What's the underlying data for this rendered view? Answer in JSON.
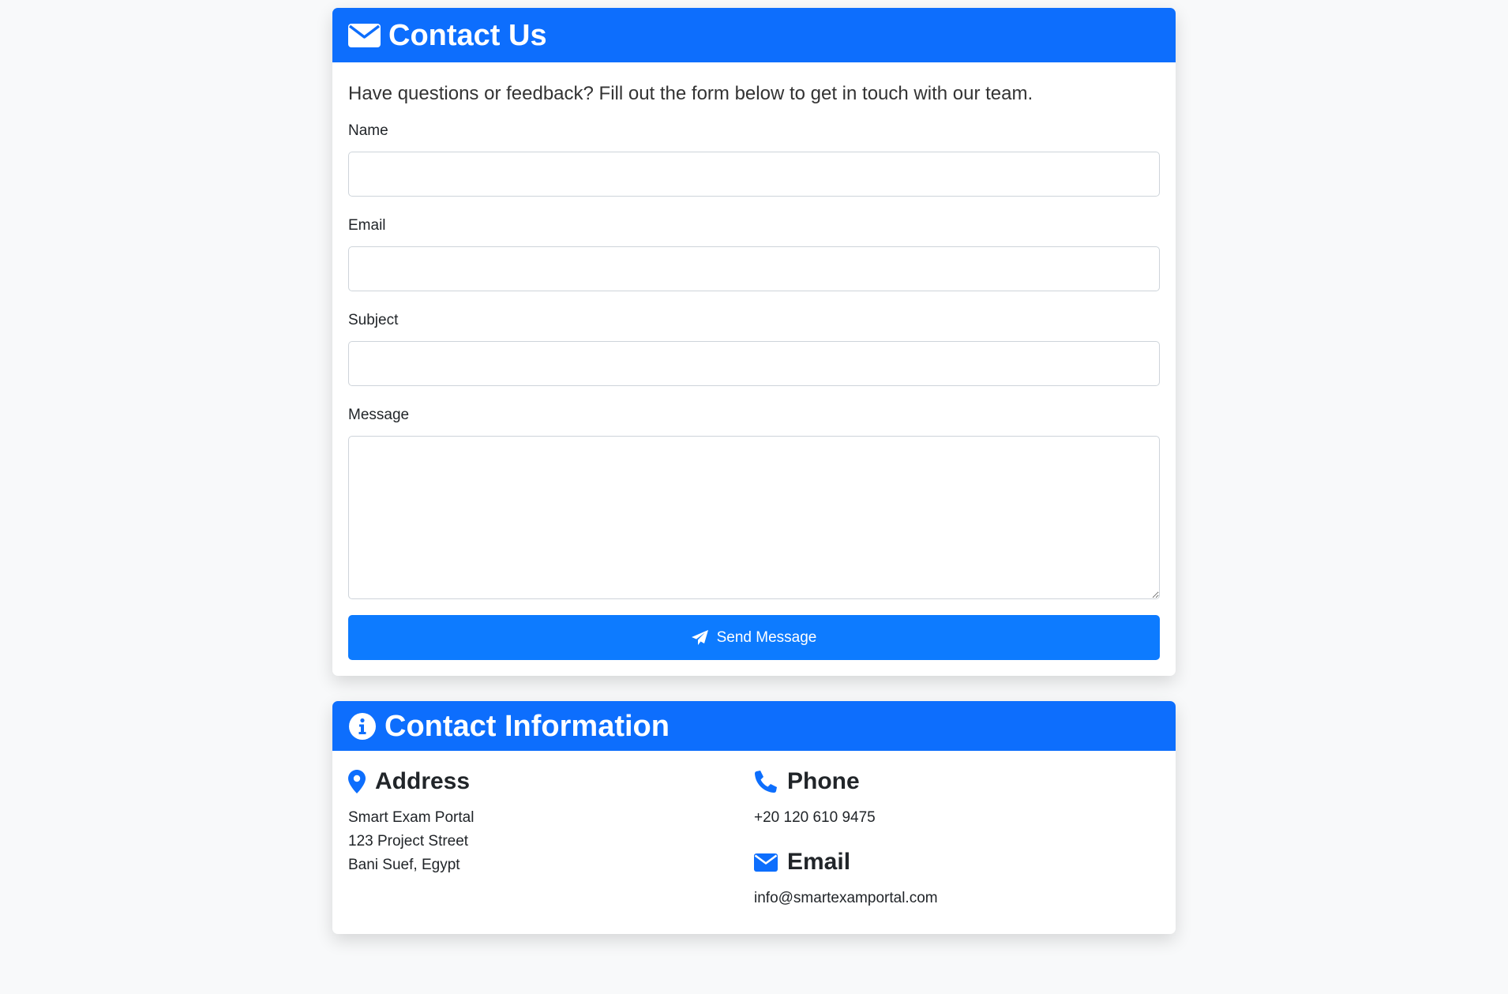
{
  "colors": {
    "primary": "#0d6efd",
    "button": "#0d7bff",
    "page_bg": "#f8f9fa"
  },
  "contact_form": {
    "title": "Contact Us",
    "title_icon": "envelope-icon",
    "intro": "Have questions or feedback? Fill out the form below to get in touch with our team.",
    "fields": {
      "name": {
        "label": "Name",
        "value": ""
      },
      "email": {
        "label": "Email",
        "value": ""
      },
      "subject": {
        "label": "Subject",
        "value": ""
      },
      "message": {
        "label": "Message",
        "value": ""
      }
    },
    "submit": {
      "label": "Send Message",
      "icon": "paper-plane-icon"
    }
  },
  "contact_info": {
    "title": "Contact Information",
    "title_icon": "info-circle-icon",
    "address": {
      "heading": "Address",
      "icon": "map-pin-icon",
      "lines": [
        "Smart Exam Portal",
        "123 Project Street",
        "Bani Suef, Egypt"
      ]
    },
    "phone": {
      "heading": "Phone",
      "icon": "phone-icon",
      "value": "+20 120 610 9475"
    },
    "email": {
      "heading": "Email",
      "icon": "envelope-icon",
      "value": "info@smartexamportal.com"
    }
  }
}
